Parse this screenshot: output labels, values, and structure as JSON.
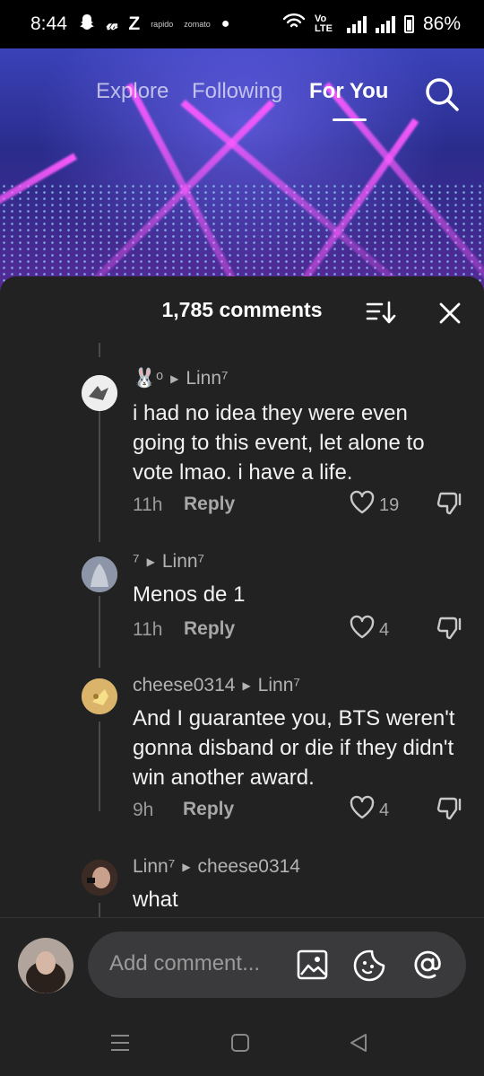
{
  "status_bar": {
    "time": "8:44",
    "icons_left": [
      "snapchat-icon",
      "app-icon",
      "z-icon",
      "rapido-icon",
      "zomato-icon",
      "dot-icon"
    ],
    "mini_labels": [
      "rapido",
      "zomato"
    ],
    "volte_label": "Vo LTE",
    "battery_percent": "86%"
  },
  "top_nav": {
    "tabs": [
      "Explore",
      "Following",
      "For You"
    ],
    "active_tab": "For You"
  },
  "comments": {
    "count_label": "1,785 comments",
    "items": [
      {
        "author_prefix": "🐰ᵒ",
        "reply_to": "Linn⁷",
        "text": "i had no idea they were even going to this event, let alone to vote lmao. i have a life.",
        "time": "11h",
        "reply_label": "Reply",
        "likes": "19"
      },
      {
        "author_prefix": "⁷",
        "reply_to": "Linn⁷",
        "text": "Menos de 1",
        "time": "11h",
        "reply_label": "Reply",
        "likes": "4"
      },
      {
        "author_prefix": "cheese0314",
        "reply_to": "Linn⁷",
        "text": "And I guarantee you, BTS weren't gonna disband or die if they didn't win another award.",
        "time": "9h",
        "reply_label": "Reply",
        "likes": "4"
      },
      {
        "author_prefix": "Linn⁷",
        "reply_to": "cheese0314",
        "text": "what",
        "time": "",
        "reply_label": "",
        "likes": ""
      }
    ]
  },
  "composer": {
    "placeholder": "Add comment...",
    "icons": [
      "image-icon",
      "emoji-sticker-icon",
      "mention-icon"
    ]
  },
  "colors": {
    "sheet_bg": "#222223",
    "accent_beam": "#ff5aff",
    "input_bg": "#3a3a3c"
  }
}
